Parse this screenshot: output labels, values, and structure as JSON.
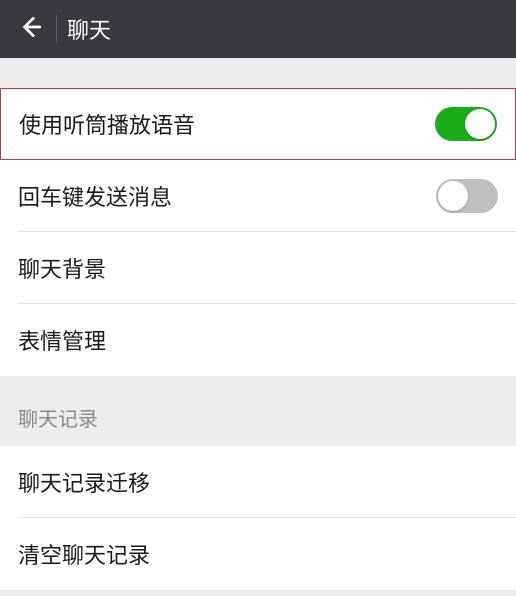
{
  "header": {
    "title": "聊天"
  },
  "rows": {
    "earpiece": {
      "label": "使用听筒播放语音",
      "on": true
    },
    "enter_send": {
      "label": "回车键发送消息",
      "on": false
    },
    "background": {
      "label": "聊天背景"
    },
    "stickers": {
      "label": "表情管理"
    }
  },
  "section_history": {
    "title": "聊天记录",
    "migrate": {
      "label": "聊天记录迁移"
    },
    "clear": {
      "label": "清空聊天记录"
    }
  }
}
